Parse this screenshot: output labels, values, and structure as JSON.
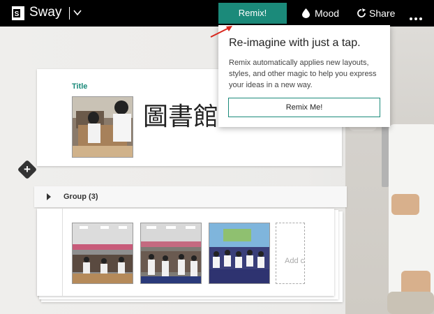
{
  "app": {
    "name": "Sway",
    "logo_letter": "S",
    "logo_color": "#1b8a7a"
  },
  "topbar": {
    "remix_label": "Remix!",
    "mood_label": "Mood",
    "share_label": "Share",
    "icons": [
      "sway-logo-icon",
      "chevron-down-icon",
      "drop-icon",
      "share-icon",
      "more-icon"
    ]
  },
  "title_card": {
    "label": "Title",
    "title_text": "圖書館"
  },
  "group": {
    "label": "Group (3)",
    "add_slot_text": "Add c"
  },
  "remix_popup": {
    "heading": "Re-imagine with just a tap.",
    "body": "Remix automatically applies new layouts, styles, and other magic to help you express your ideas in a new way.",
    "button_label": "Remix Me!"
  },
  "colors": {
    "accent": "#1b8a7a",
    "topbar": "#000000",
    "arrow": "#d9261c"
  }
}
